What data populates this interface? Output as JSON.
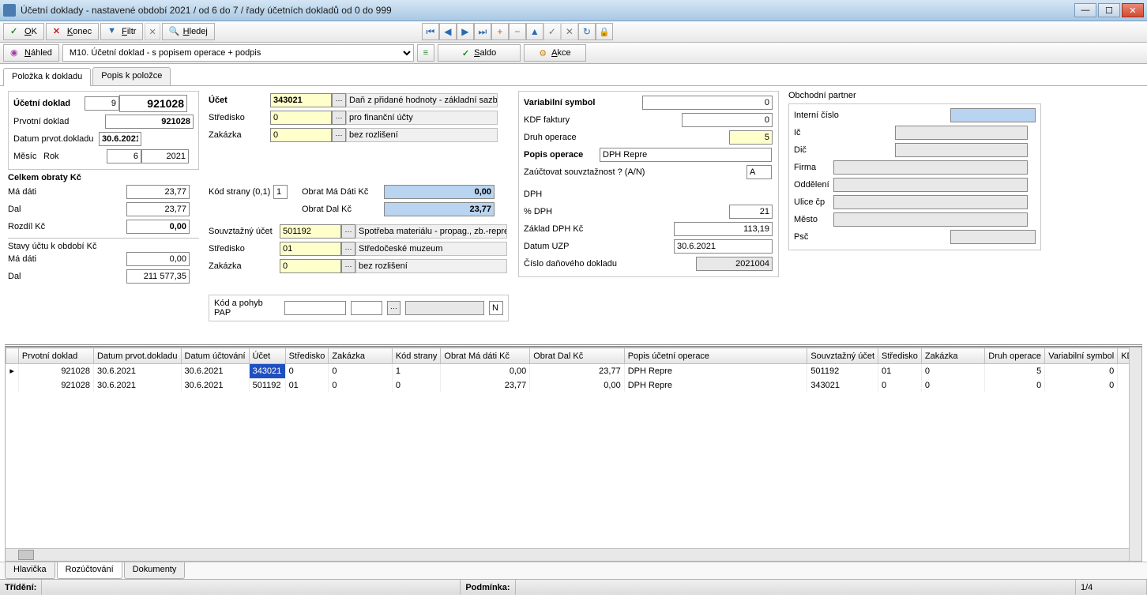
{
  "window": {
    "title": "Účetní doklady - nastavené období 2021 / od 6 do 7 / řady účetních dokladů od 0 do 999"
  },
  "toolbar": {
    "ok": "OK",
    "konec": "Konec",
    "filtr": "Filtr",
    "hledej": "Hledej",
    "nahled": "Náhled",
    "template": "M10. Účetní doklad - s popisem operace + podpis",
    "saldo": "Saldo",
    "akce": "Akce"
  },
  "tabs": {
    "polozka": "Položka k dokladu",
    "popis": "Popis k položce"
  },
  "doc": {
    "header_lbl": "Účetní doklad",
    "header_seq": "9",
    "header_num": "921028",
    "prvotni_lbl": "Prvotní doklad",
    "prvotni_val": "921028",
    "datum_lbl": "Datum prvot.dokladu",
    "datum_val": "30.6.2021",
    "mesic_lbl": "Měsíc",
    "rok_lbl": "Rok",
    "mesic_val": "6",
    "rok_val": "2021"
  },
  "obraty": {
    "header": "Celkem obraty Kč",
    "madati_lbl": "Má dáti",
    "madati_val": "23,77",
    "dal_lbl": "Dal",
    "dal_val": "23,77",
    "rozdil_lbl": "Rozdíl Kč",
    "rozdil_val": "0,00"
  },
  "stavy": {
    "header": "Stavy účtu k období Kč",
    "madati_lbl": "Má dáti",
    "madati_val": "0,00",
    "dal_lbl": "Dal",
    "dal_val": "211 577,35"
  },
  "ucet": {
    "ucet_lbl": "Účet",
    "ucet_val": "343021",
    "ucet_desc": "Daň z přidané hodnoty - základní sazba",
    "stred_lbl": "Středisko",
    "stred_val": "0",
    "stred_desc": "pro finanční účty",
    "zak_lbl": "Zakázka",
    "zak_val": "0",
    "zak_desc": "bez rozlišení",
    "kodstrany_lbl": "Kód strany (0,1)",
    "kodstrany_val": "1",
    "obrat_md_lbl": "Obrat Má Dáti Kč",
    "obrat_md_val": "0,00",
    "obrat_dal_lbl": "Obrat Dal Kč",
    "obrat_dal_val": "23,77"
  },
  "souv": {
    "ucet_lbl": "Souvztažný účet",
    "ucet_val": "501192",
    "ucet_desc": "Spotřeba materiálu - propag., zb.-repre",
    "stred_lbl": "Středisko",
    "stred_val": "01",
    "stred_desc": "Středočeské muzeum",
    "zak_lbl": "Zakázka",
    "zak_val": "0",
    "zak_desc": "bez rozlišení",
    "kodpap_lbl": "Kód a pohyb PAP",
    "kodpap_n": "N"
  },
  "op": {
    "vs_lbl": "Variabilní symbol",
    "vs_val": "0",
    "kdf_lbl": "KDF faktury",
    "kdf_val": "0",
    "druh_lbl": "Druh operace",
    "druh_val": "5",
    "popis_lbl": "Popis operace",
    "popis_val": "DPH Repre",
    "zauct_lbl": "Zaúčtovat souvztažnost ? (A/N)",
    "zauct_val": "A",
    "dph_lbl": "DPH",
    "pctdph_lbl": "% DPH",
    "pctdph_val": "21",
    "zaklad_lbl": "Základ DPH Kč",
    "zaklad_val": "113,19",
    "uzp_lbl": "Datum UZP",
    "uzp_val": "30.6.2021",
    "cddok_lbl": "Číslo daňového dokladu",
    "cddok_val": "2021004"
  },
  "partner": {
    "header": "Obchodní partner",
    "interni_lbl": "Interní číslo",
    "ic_lbl": "Ič",
    "dic_lbl": "Dič",
    "firma_lbl": "Firma",
    "odd_lbl": "Oddělení",
    "ulice_lbl": "Ulice čp",
    "mesto_lbl": "Město",
    "psc_lbl": "Psč"
  },
  "grid": {
    "headers": [
      "",
      "Prvotní doklad",
      "Datum prvot.dokladu",
      "Datum účtování",
      "Účet",
      "Středisko",
      "Zakázka",
      "Kód strany",
      "Obrat Má dáti Kč",
      "Obrat Dal Kč",
      "Popis účetní operace",
      "Souvztažný účet",
      "Středisko",
      "Zakázka",
      "Druh operace",
      "Variabilní symbol",
      "KD"
    ],
    "rows": [
      {
        "ind": "▸",
        "prvotni": "921028",
        "dprv": "30.6.2021",
        "duct": "30.6.2021",
        "ucet": "343021",
        "stred": "0",
        "zak": "0",
        "ks": "1",
        "md": "0,00",
        "dal": "23,77",
        "popis": "DPH Repre",
        "souv": "501192",
        "sstred": "01",
        "szak": "0",
        "druh": "5",
        "vs": "0"
      },
      {
        "ind": "",
        "prvotni": "921028",
        "dprv": "30.6.2021",
        "duct": "30.6.2021",
        "ucet": "501192",
        "stred": "01",
        "zak": "0",
        "ks": "0",
        "md": "23,77",
        "dal": "0,00",
        "popis": "DPH Repre",
        "souv": "343021",
        "sstred": "0",
        "szak": "0",
        "druh": "0",
        "vs": "0"
      }
    ]
  },
  "btabs": {
    "hlavicka": "Hlavička",
    "rozuct": "Rozúčtování",
    "dokumenty": "Dokumenty"
  },
  "status": {
    "trideni_lbl": "Třídění:",
    "podminka_lbl": "Podmínka:",
    "counter": "1/4"
  }
}
